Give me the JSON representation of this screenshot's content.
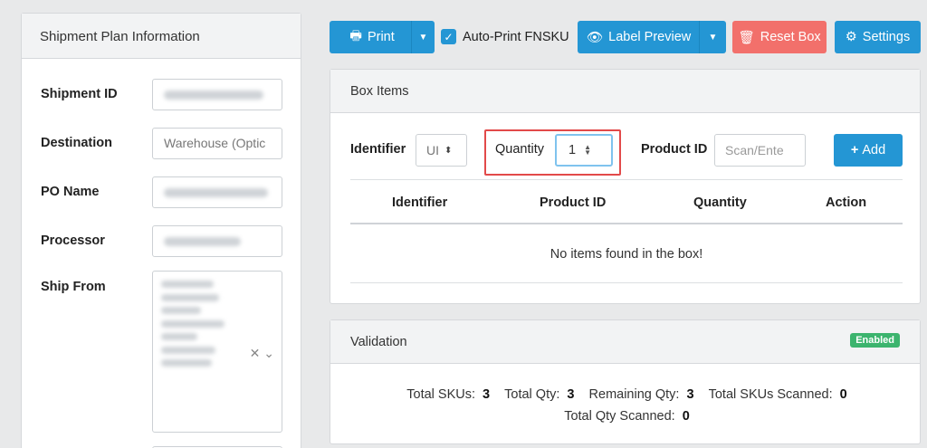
{
  "shipment_panel": {
    "title": "Shipment Plan Information",
    "fields": [
      {
        "label": "Shipment ID",
        "value": ""
      },
      {
        "label": "Destination",
        "value": "Warehouse (Optic"
      },
      {
        "label": "PO Name",
        "value": ""
      },
      {
        "label": "Processor",
        "value": ""
      },
      {
        "label": "Ship From",
        "value": ""
      }
    ]
  },
  "toolbar": {
    "print_label": "Print",
    "auto_print_label": "Auto-Print FNSKU",
    "label_preview_label": "Label Preview",
    "reset_box_label": "Reset Box",
    "settings_label": "Settings"
  },
  "box_items": {
    "title": "Box Items",
    "identifier_label": "Identifier",
    "identifier_value": "UI",
    "quantity_label": "Quantity",
    "quantity_value": "1",
    "product_id_label": "Product ID",
    "product_id_placeholder": "Scan/Ente",
    "add_label": "Add",
    "columns": [
      "Identifier",
      "Product ID",
      "Quantity",
      "Action"
    ],
    "empty_text": "No items found in the box!"
  },
  "validation": {
    "title": "Validation",
    "status_badge": "Enabled",
    "total_skus_label": "Total SKUs:",
    "total_skus": "3",
    "total_qty_label": "Total Qty:",
    "total_qty": "3",
    "remaining_qty_label": "Remaining Qty:",
    "remaining_qty": "3",
    "total_skus_scanned_label": "Total SKUs Scanned:",
    "total_skus_scanned": "0",
    "total_qty_scanned_label": "Total Qty Scanned:",
    "total_qty_scanned": "0"
  },
  "colors": {
    "primary": "#2496d4",
    "danger": "#f2706b",
    "success": "#3cb46e",
    "highlight": "#e24a4a"
  }
}
